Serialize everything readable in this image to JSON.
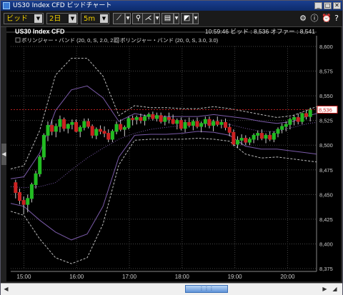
{
  "window": {
    "title": "US30 Index CFD ビッドチャート",
    "controls": [
      "_",
      "□",
      "✕"
    ]
  },
  "toolbar": {
    "price_type": "ビッド",
    "period": "2日",
    "interval": "5m",
    "tools": [
      "line-draw-icon",
      "pin-icon",
      "fan-icon",
      "print-icon",
      "chart-image-icon"
    ],
    "right_icons": [
      "settings-icon",
      "info-icon",
      "alarm-icon",
      "help-icon"
    ]
  },
  "header": {
    "symbol": "US30 Index CFD",
    "time": "10:59:46",
    "bid_label": "ビッド : ",
    "bid": "8,536",
    "offer_label": "オファー : ",
    "offer": "8,541"
  },
  "legend": [
    {
      "label": "ボリンジャー・バンド (20, 0, S, 2.0, 2.0)",
      "color": "#7a5aa8"
    },
    {
      "label": "ボリンジャー・バンド (20, 0, S, 3.0, 3.0)",
      "color": "#bbbbbb"
    }
  ],
  "chart_data": {
    "type": "candlestick",
    "y_ticks": [
      "8,600",
      "8,575",
      "8,550",
      "8,525",
      "8,500",
      "8,475",
      "8,450",
      "8,425",
      "8,400",
      "8,375"
    ],
    "y_tick_values": [
      8600,
      8575,
      8550,
      8525,
      8500,
      8475,
      8450,
      8425,
      8400,
      8375
    ],
    "ylim": [
      8375,
      8600
    ],
    "x_ticks": [
      "15:00",
      "16:00",
      "17:00",
      "18:00",
      "19:00",
      "20:00"
    ],
    "x_tick_hours": [
      15,
      16,
      17,
      18,
      19,
      20
    ],
    "x_range_hours": [
      14.75,
      20.55
    ],
    "current_price_label": "8,536",
    "current_price": 8536,
    "up_color": "#22bb22",
    "down_color": "#cc2222",
    "candles": [
      [
        8462,
        8465,
        8446,
        8452
      ],
      [
        8452,
        8456,
        8440,
        8444
      ],
      [
        8444,
        8448,
        8430,
        8440
      ],
      [
        8440,
        8450,
        8432,
        8446
      ],
      [
        8446,
        8462,
        8442,
        8460
      ],
      [
        8460,
        8474,
        8456,
        8471
      ],
      [
        8471,
        8490,
        8468,
        8488
      ],
      [
        8488,
        8512,
        8485,
        8510
      ],
      [
        8510,
        8524,
        8504,
        8520
      ],
      [
        8520,
        8526,
        8510,
        8514
      ],
      [
        8514,
        8522,
        8508,
        8519
      ],
      [
        8519,
        8530,
        8513,
        8526
      ],
      [
        8526,
        8528,
        8514,
        8517
      ],
      [
        8517,
        8522,
        8512,
        8521
      ],
      [
        8521,
        8526,
        8516,
        8523
      ],
      [
        8523,
        8526,
        8513,
        8514
      ],
      [
        8514,
        8520,
        8508,
        8518
      ],
      [
        8518,
        8527,
        8515,
        8524
      ],
      [
        8524,
        8527,
        8517,
        8519
      ],
      [
        8519,
        8521,
        8507,
        8510
      ],
      [
        8510,
        8518,
        8506,
        8516
      ],
      [
        8516,
        8520,
        8511,
        8514
      ],
      [
        8514,
        8519,
        8508,
        8512
      ],
      [
        8512,
        8516,
        8503,
        8506
      ],
      [
        8506,
        8516,
        8503,
        8514
      ],
      [
        8514,
        8524,
        8511,
        8521
      ],
      [
        8521,
        8526,
        8514,
        8516
      ],
      [
        8516,
        8520,
        8509,
        8518
      ],
      [
        8518,
        8529,
        8516,
        8527
      ],
      [
        8527,
        8530,
        8520,
        8526
      ],
      [
        8526,
        8530,
        8521,
        8528
      ],
      [
        8528,
        8532,
        8522,
        8525
      ],
      [
        8525,
        8531,
        8520,
        8529
      ],
      [
        8529,
        8533,
        8526,
        8531
      ],
      [
        8531,
        8534,
        8525,
        8527
      ],
      [
        8527,
        8533,
        8524,
        8530
      ],
      [
        8530,
        8533,
        8522,
        8524
      ],
      [
        8524,
        8530,
        8520,
        8528
      ],
      [
        8528,
        8533,
        8522,
        8526
      ],
      [
        8526,
        8531,
        8521,
        8522
      ],
      [
        8522,
        8527,
        8516,
        8525
      ],
      [
        8525,
        8528,
        8515,
        8517
      ],
      [
        8517,
        8526,
        8513,
        8523
      ],
      [
        8523,
        8528,
        8518,
        8520
      ],
      [
        8520,
        8526,
        8515,
        8524
      ],
      [
        8524,
        8528,
        8517,
        8519
      ],
      [
        8519,
        8524,
        8513,
        8522
      ],
      [
        8522,
        8529,
        8518,
        8526
      ],
      [
        8526,
        8529,
        8517,
        8520
      ],
      [
        8520,
        8526,
        8514,
        8524
      ],
      [
        8524,
        8529,
        8519,
        8521
      ],
      [
        8521,
        8526,
        8517,
        8523
      ],
      [
        8523,
        8527,
        8515,
        8518
      ],
      [
        8518,
        8522,
        8509,
        8513
      ],
      [
        8513,
        8516,
        8499,
        8501
      ],
      [
        8501,
        8509,
        8497,
        8505
      ],
      [
        8505,
        8511,
        8500,
        8507
      ],
      [
        8507,
        8510,
        8500,
        8503
      ],
      [
        8503,
        8508,
        8500,
        8506
      ],
      [
        8506,
        8512,
        8502,
        8510
      ],
      [
        8510,
        8515,
        8505,
        8512
      ],
      [
        8512,
        8516,
        8505,
        8507
      ],
      [
        8507,
        8512,
        8502,
        8510
      ],
      [
        8510,
        8514,
        8504,
        8506
      ],
      [
        8506,
        8514,
        8503,
        8512
      ],
      [
        8512,
        8518,
        8508,
        8516
      ],
      [
        8516,
        8522,
        8512,
        8519
      ],
      [
        8519,
        8524,
        8514,
        8521
      ],
      [
        8521,
        8528,
        8516,
        8526
      ],
      [
        8526,
        8531,
        8520,
        8528
      ],
      [
        8528,
        8532,
        8521,
        8524
      ],
      [
        8524,
        8533,
        8521,
        8532
      ],
      [
        8532,
        8535,
        8526,
        8529
      ],
      [
        8529,
        8538,
        8524,
        8536
      ]
    ],
    "bands": {
      "x": [
        14.75,
        15.0,
        15.3,
        15.6,
        15.9,
        16.2,
        16.5,
        16.8,
        17.1,
        17.4,
        17.7,
        18.0,
        18.3,
        18.6,
        18.9,
        19.2,
        19.5,
        19.8,
        20.1,
        20.4,
        20.55
      ],
      "mid": [
        8458,
        8457,
        8458,
        8462,
        8475,
        8487,
        8497,
        8506,
        8512,
        8516,
        8518,
        8520,
        8521,
        8522,
        8521,
        8517,
        8514,
        8514,
        8518,
        8522,
        8523
      ],
      "upper2": [
        8466,
        8468,
        8492,
        8535,
        8556,
        8560,
        8548,
        8524,
        8532,
        8529,
        8529,
        8529,
        8529,
        8531,
        8529,
        8527,
        8524,
        8522,
        8524,
        8530,
        8532
      ],
      "lower2": [
        8441,
        8438,
        8424,
        8412,
        8404,
        8410,
        8438,
        8488,
        8510,
        8511,
        8511,
        8512,
        8514,
        8513,
        8510,
        8499,
        8496,
        8496,
        8494,
        8492,
        8491
      ],
      "upper3": [
        8476,
        8479,
        8515,
        8571,
        8588,
        8588,
        8570,
        8530,
        8540,
        8538,
        8538,
        8537,
        8537,
        8539,
        8537,
        8534,
        8531,
        8528,
        8530,
        8536,
        8539
      ],
      "lower3": [
        8433,
        8429,
        8405,
        8386,
        8380,
        8386,
        8420,
        8480,
        8505,
        8506,
        8506,
        8506,
        8507,
        8506,
        8504,
        8491,
        8487,
        8488,
        8486,
        8484,
        8483
      ]
    }
  }
}
